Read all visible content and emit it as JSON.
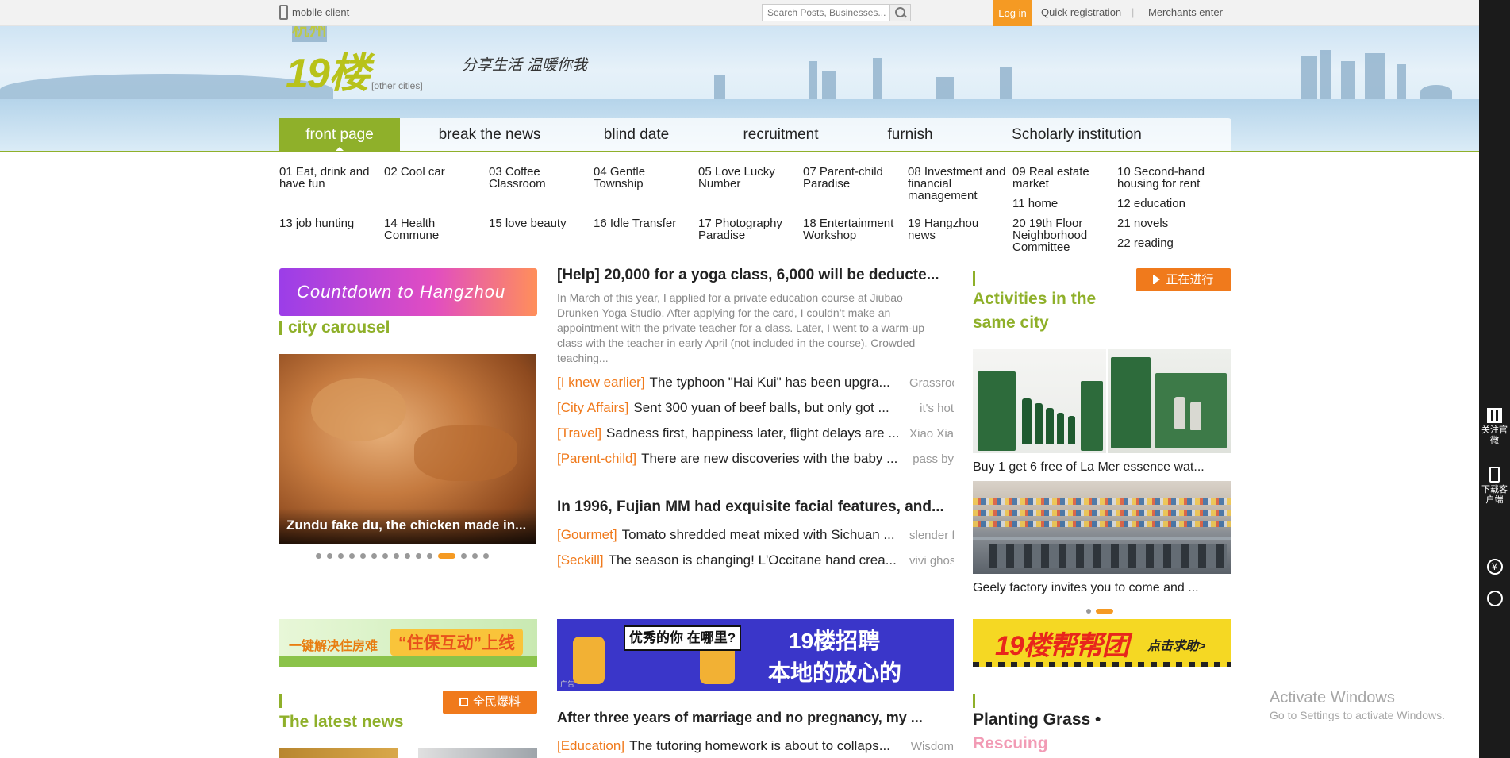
{
  "topbar": {
    "mobile_label": "mobile client",
    "search_placeholder": "Search Posts, Businesses...",
    "login_label": "Log in",
    "register_label": "Quick registration",
    "separator": "|",
    "merchants_label": "Merchants enter"
  },
  "logo": {
    "brand": "19楼",
    "city": "杭州",
    "other_cities": "[other cities]",
    "slogan": "分享生活 温暖你我"
  },
  "nav": {
    "items": [
      "front page",
      "break the news",
      "blind date",
      "recruitment",
      "furnish",
      "Scholarly institution"
    ],
    "active_index": 0
  },
  "categories": [
    "01 Eat, drink and have fun",
    "02 Cool car",
    "03 Coffee Classroom",
    "04 Gentle Township",
    "05 Love Lucky Number",
    "07 Parent-child Paradise",
    "08 Investment and financial management",
    "09 Real estate market",
    "10 Second-hand housing for rent",
    "11 home",
    "12 education",
    "13 job hunting",
    "14 Health Commune",
    "15 love beauty",
    "16 Idle Transfer",
    "17 Photography Paradise",
    "18 Entertainment Workshop",
    "19 Hangzhou news",
    "20 19th Floor Neighborhood Committee",
    "21 novels",
    "22 reading"
  ],
  "left": {
    "countdown_banner": "Countdown to Hangzhou",
    "section_title": "city carousel",
    "carousel_caption": "Zundu fake du, the chicken made in...",
    "dots_total": 15,
    "dots_active": 11
  },
  "middle": {
    "headline1": "[Help] 20,000 for a yoga class, 6,000 will be deducte...",
    "desc1": "In March of this year, I applied for a private education course at Jiubao Drunken Yoga Studio. After applying for the card, I couldn’t make an appointment with the private teacher for a class. Later, I went to a warm-up class with the teacher in early April (not included in the course). Crowded teaching...",
    "news1": [
      {
        "tag": "[I knew earlier]",
        "text": "The typhoon \"Hai Kui\" has been upgra...",
        "source": "Grassroo"
      },
      {
        "tag": "[City Affairs]",
        "text": "Sent 300 yuan of beef balls, but only got ...",
        "source": "it's hot"
      },
      {
        "tag": "[Travel]",
        "text": "Sadness first, happiness later, flight delays are ...",
        "source": "Xiao Xia"
      },
      {
        "tag": "[Parent-child]",
        "text": "There are new discoveries with the baby ...",
        "source": "pass by"
      }
    ],
    "headline2": "In 1996, Fujian MM had exquisite facial features, and...",
    "news2": [
      {
        "tag": "[Gourmet]",
        "text": "Tomato shredded meat mixed with Sichuan ...",
        "source": "slender f"
      },
      {
        "tag": "[Seckill]",
        "text": "The season is changing! L'Occitane hand crea...",
        "source": "vivi ghos"
      }
    ],
    "headline3": "After three years of marriage and no pregnancy, my ...",
    "news3": [
      {
        "tag": "[Education]",
        "text": "The tutoring homework is about to collaps...",
        "source": "Wisdom"
      }
    ]
  },
  "right": {
    "ongoing_label": "正在进行",
    "section_title": "Activities in the same city",
    "caption1": "Buy 1 get 6 free of La Mer essence wat...",
    "caption2": "Geely factory invites you to come and ...",
    "dots_total": 2,
    "dots_active": 1,
    "bottom_title_1": "Planting Grass •",
    "bottom_title_2": "Rescuing"
  },
  "ads": {
    "ad1_text1": "一键解决住房难",
    "ad1_text2": "“住保互动”上线",
    "ad2_question": "优秀的你 在哪里?",
    "ad2_line1": "19楼招聘",
    "ad2_line2": "本地的放心的",
    "ad2_small": "广告",
    "ad3_title": "19楼帮帮团",
    "ad3_cta": "点击求助>"
  },
  "latest": {
    "title": "The latest news",
    "report_button": "全民爆料"
  },
  "sidebar": {
    "follow": "关注官微",
    "download": "下载客户端",
    "yen": "¥"
  },
  "watermark": {
    "line1": "Activate Windows",
    "line2": "Go to Settings to activate Windows."
  },
  "colors": {
    "brand_green": "#8fb02a",
    "accent_orange": "#f07a1c",
    "login_orange": "#f59a23"
  }
}
